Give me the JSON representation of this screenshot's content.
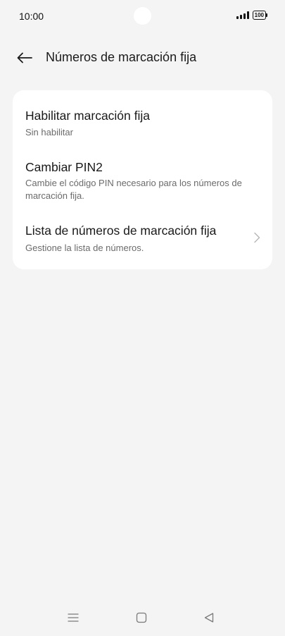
{
  "status_bar": {
    "time": "10:00",
    "battery": "100"
  },
  "header": {
    "title": "Números de marcación fija"
  },
  "settings": {
    "items": [
      {
        "title": "Habilitar marcación fija",
        "subtitle": "Sin habilitar"
      },
      {
        "title": "Cambiar PIN2",
        "subtitle": "Cambie el código PIN necesario para los números de marcación fija."
      },
      {
        "title": "Lista de números de marcación fija",
        "subtitle": "Gestione la lista de números."
      }
    ]
  },
  "icons": {
    "back": "arrow-left-icon",
    "chevron": "chevron-right-icon",
    "nav_menu": "menu-icon",
    "nav_home": "home-square-icon",
    "nav_back": "back-triangle-icon",
    "signal": "signal-icon",
    "battery": "battery-icon"
  }
}
